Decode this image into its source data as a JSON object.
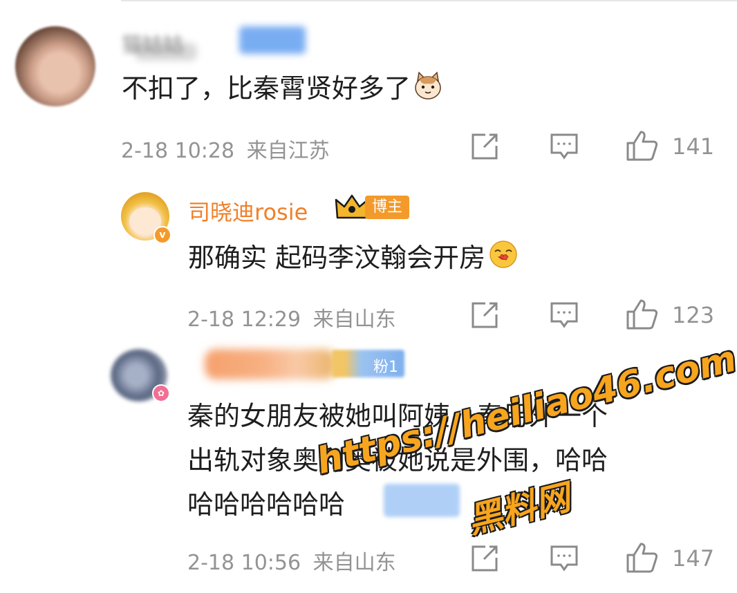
{
  "comments": [
    {
      "username": "猫姑姑",
      "text": "不扣了，比秦霄贤好多了",
      "time": "2-18 10:28",
      "location": "来自江苏",
      "likes": "141",
      "emoji": "cat-face-emoji"
    },
    {
      "username": "司晓迪rosie",
      "badge": "博主",
      "text": "那确实 起码李汶翰会开房",
      "time": "2-18 12:29",
      "location": "来自山东",
      "likes": "123",
      "emoji": "face-blowing-kiss-emoji"
    },
    {
      "fan_badge": "粉1",
      "text_line1": "秦的女朋友被她叫阿姨，秦另外一个",
      "text_line2": "出轨对象奥利奥被她说是外围，哈哈",
      "text_line3": "哈哈哈哈哈哈",
      "time": "2-18 10:56",
      "location": "来自山东",
      "likes": "147"
    }
  ],
  "watermark": {
    "url": "https://heiliao46.com",
    "name": "黑料网"
  },
  "colors": {
    "username": "#f0802a",
    "badge": "#f39a2b",
    "meta": "#939393",
    "watermark": "#f7a51e"
  }
}
